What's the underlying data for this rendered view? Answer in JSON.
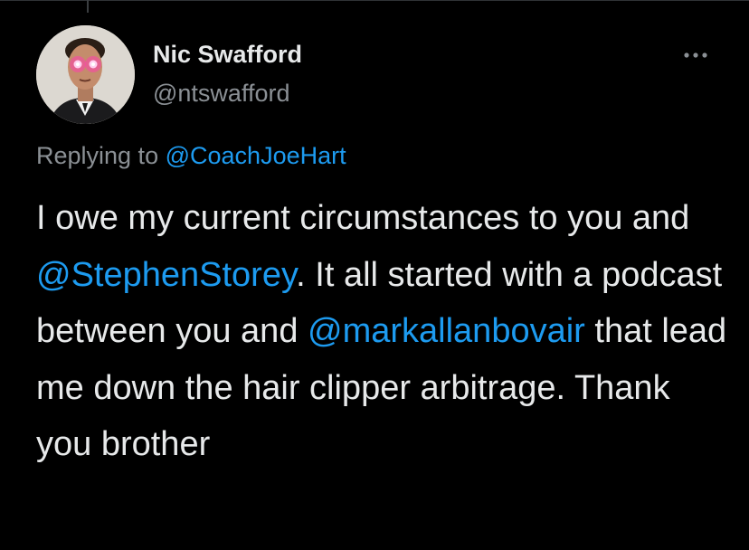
{
  "tweet": {
    "author": {
      "display_name": "Nic Swafford",
      "handle": "@ntswafford",
      "avatar_icon": "avatar-laser-eyes"
    },
    "more_icon": "ellipsis-icon",
    "reply_context": {
      "prefix": "Replying to",
      "mention": "@CoachJoeHart"
    },
    "body": {
      "text_1": "I owe my current circumstances to you and ",
      "mention_1": "@StephenStorey",
      "text_2": ". It all started with a podcast between you and ",
      "mention_2": "@markallanbovair",
      "text_3": " that lead me down the hair clipper arbitrage. Thank you brother"
    }
  },
  "colors": {
    "background": "#000000",
    "primary_text": "#e7e9ea",
    "secondary_text": "#8b9095",
    "link": "#1d9bf0"
  }
}
